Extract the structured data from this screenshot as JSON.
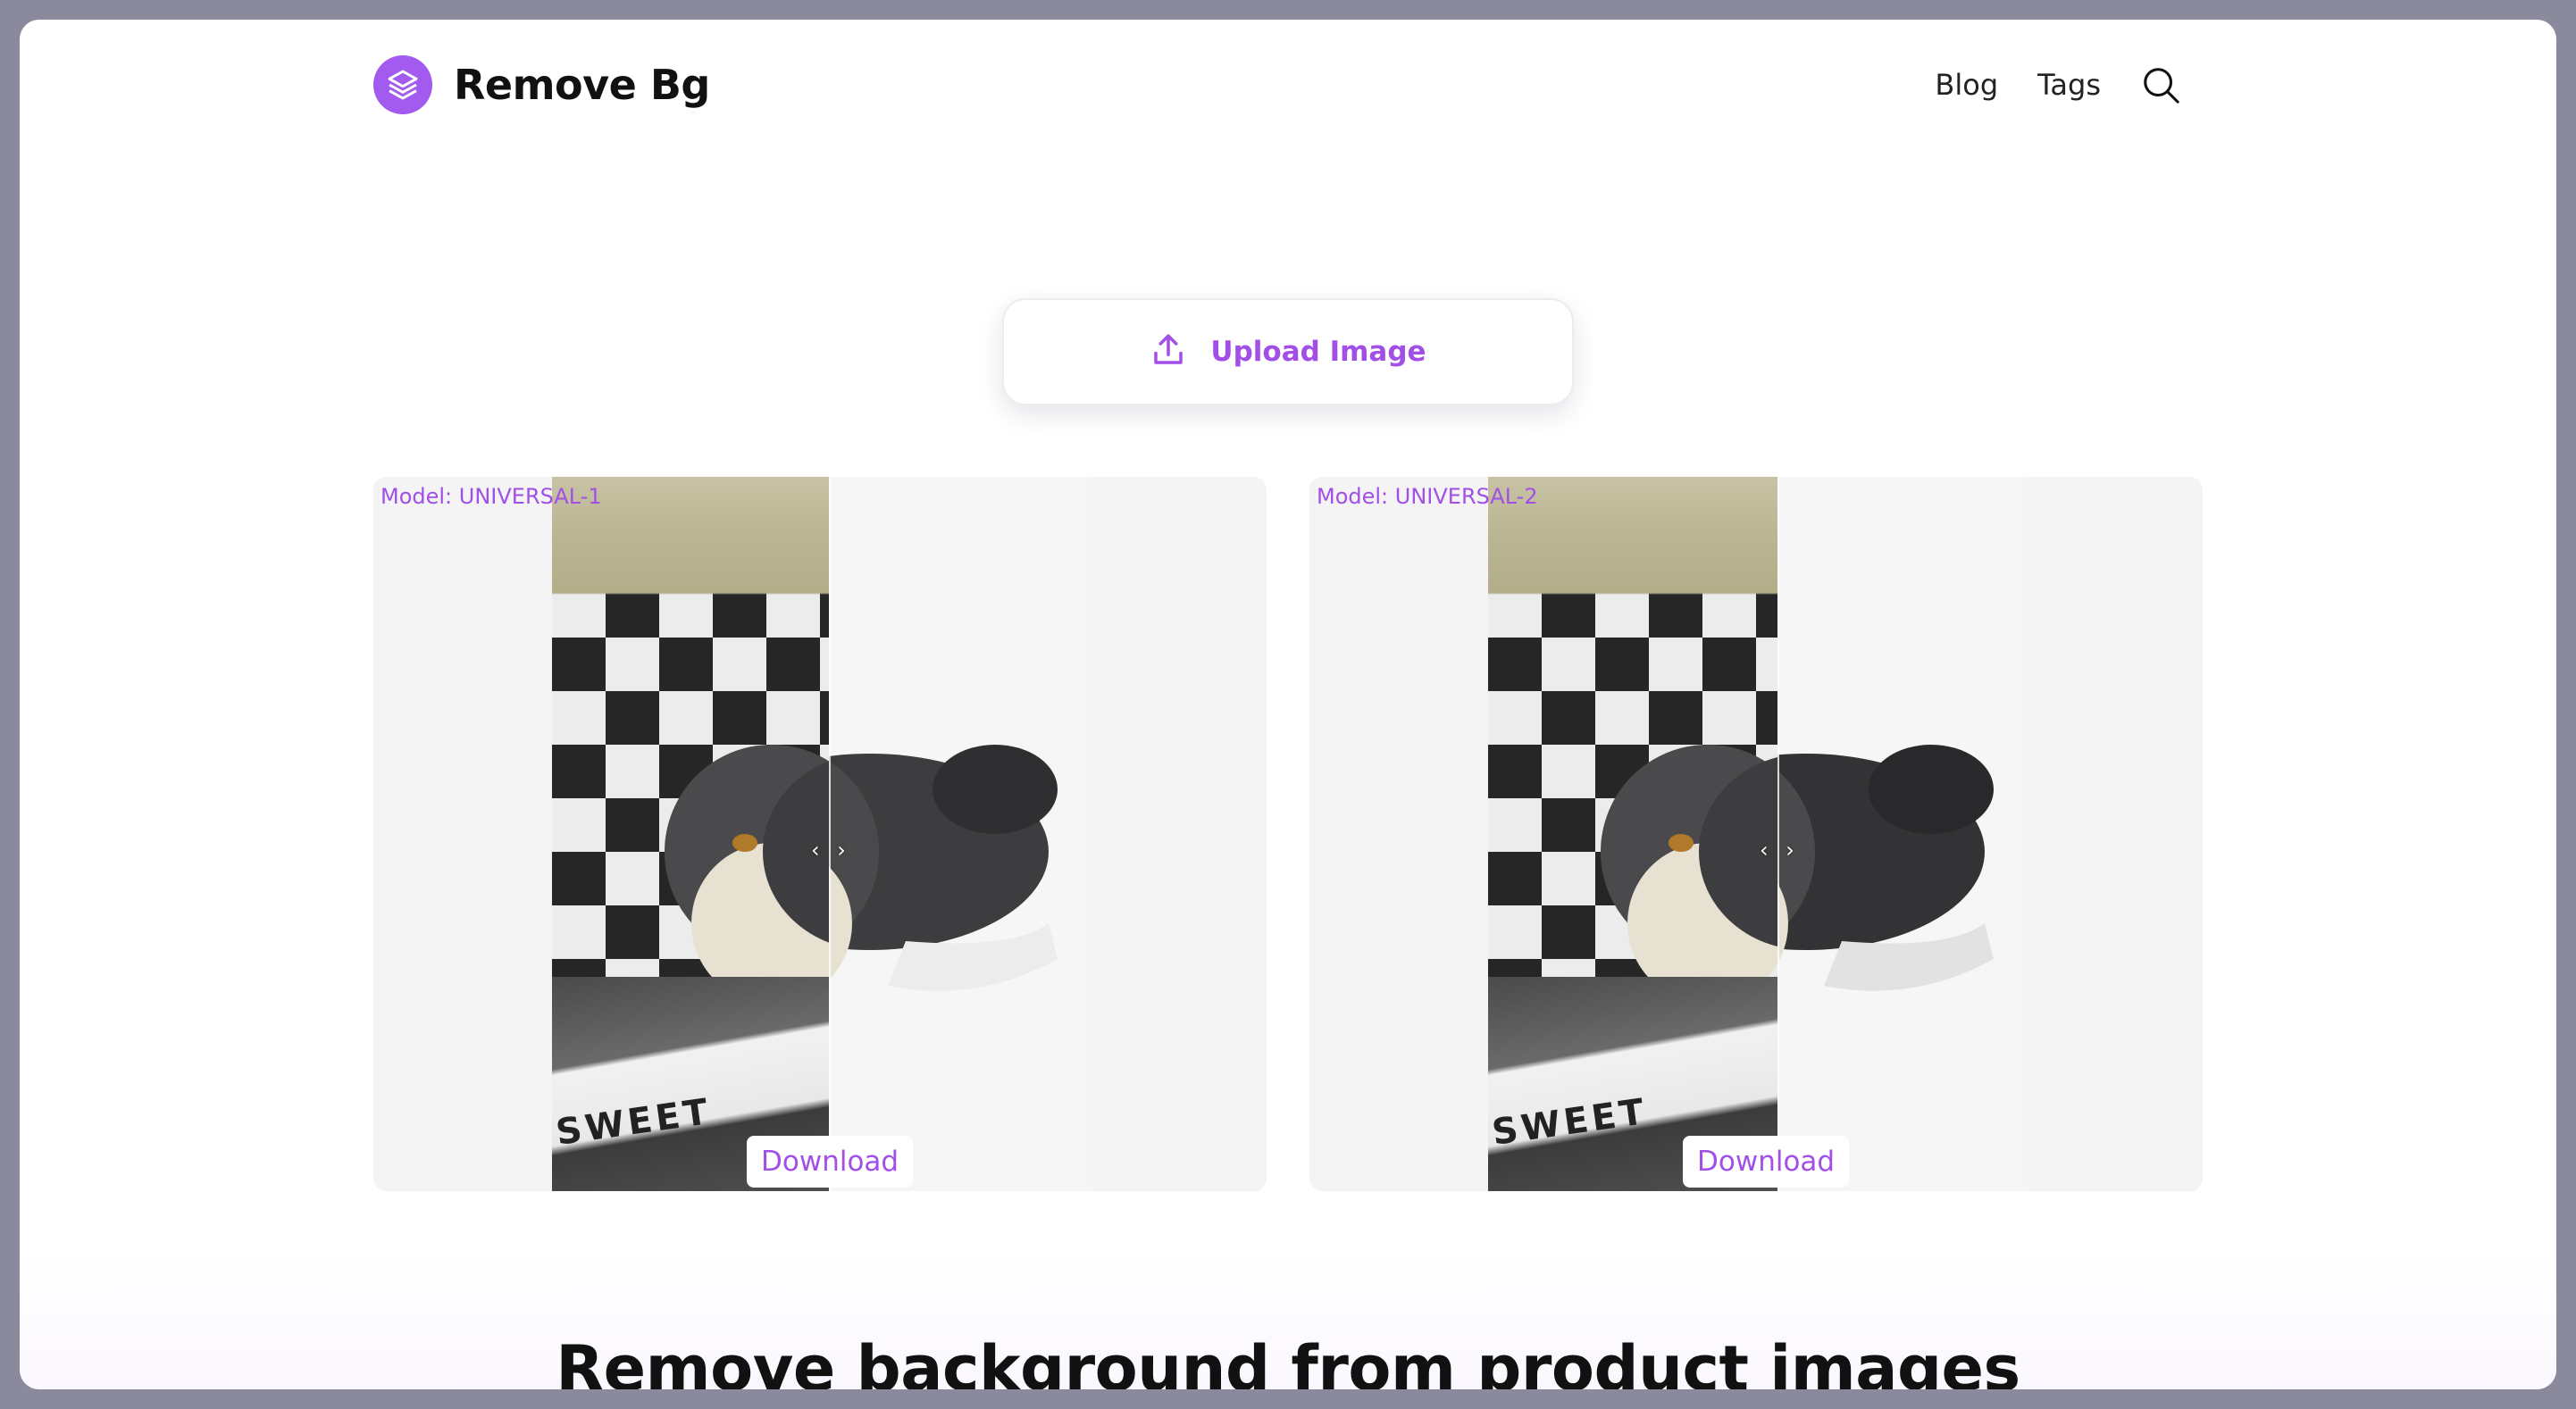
{
  "header": {
    "brand": "Remove Bg",
    "nav": [
      {
        "label": "Blog"
      },
      {
        "label": "Tags"
      }
    ],
    "search_icon": "search-icon"
  },
  "upload": {
    "label": "Upload Image",
    "icon": "upload-icon"
  },
  "panels": [
    {
      "model_label": "Model: UNIVERSAL-1",
      "download_label": "Download",
      "handle": "‹ ›"
    },
    {
      "model_label": "Model: UNIVERSAL-2",
      "download_label": "Download",
      "handle": "‹ ›"
    }
  ],
  "headline": "Remove background from product images",
  "colors": {
    "accent": "#a14fe6",
    "panel_bg": "#f4f4f5"
  }
}
